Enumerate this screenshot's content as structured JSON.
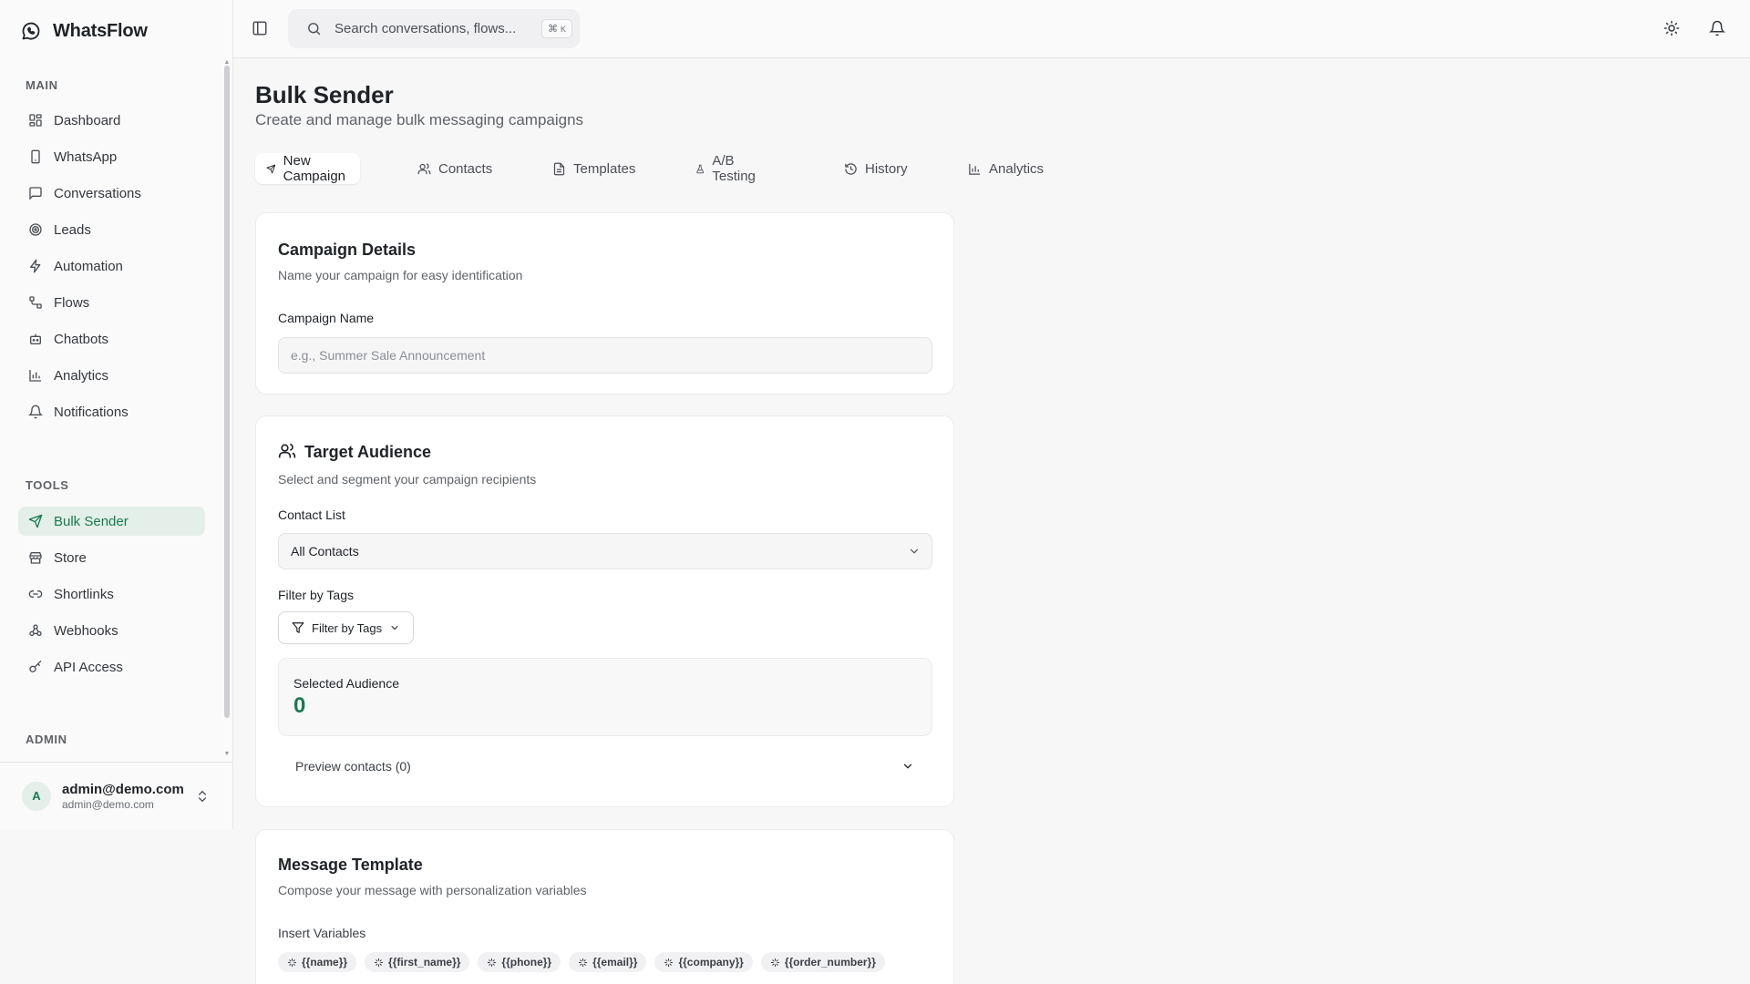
{
  "app": {
    "name": "WhatsFlow"
  },
  "sidebar": {
    "sections": {
      "main": "MAIN",
      "tools": "TOOLS",
      "admin": "ADMIN"
    },
    "main_items": [
      {
        "label": "Dashboard",
        "icon": "dashboard-icon"
      },
      {
        "label": "WhatsApp",
        "icon": "phone-icon"
      },
      {
        "label": "Conversations",
        "icon": "message-icon"
      },
      {
        "label": "Leads",
        "icon": "target-icon"
      },
      {
        "label": "Automation",
        "icon": "bolt-icon"
      },
      {
        "label": "Flows",
        "icon": "flow-icon"
      },
      {
        "label": "Chatbots",
        "icon": "bot-icon"
      },
      {
        "label": "Analytics",
        "icon": "chart-icon"
      },
      {
        "label": "Notifications",
        "icon": "bell-icon"
      }
    ],
    "tool_items": [
      {
        "label": "Bulk Sender",
        "icon": "send-icon",
        "active": true
      },
      {
        "label": "Store",
        "icon": "store-icon"
      },
      {
        "label": "Shortlinks",
        "icon": "link-icon"
      },
      {
        "label": "Webhooks",
        "icon": "webhook-icon"
      },
      {
        "label": "API Access",
        "icon": "key-icon"
      }
    ]
  },
  "user": {
    "avatar_letter": "A",
    "name": "admin@demo.com",
    "email": "admin@demo.com"
  },
  "topbar": {
    "search_placeholder": "Search conversations, flows...",
    "shortcut": {
      "symbol": "⌘",
      "key": "K"
    }
  },
  "page": {
    "title": "Bulk Sender",
    "subtitle": "Create and manage bulk messaging campaigns"
  },
  "tabs": [
    {
      "label": "New Campaign",
      "icon": "send-icon",
      "active": true
    },
    {
      "label": "Contacts",
      "icon": "users-icon"
    },
    {
      "label": "Templates",
      "icon": "file-icon"
    },
    {
      "label": "A/B Testing",
      "icon": "flask-icon"
    },
    {
      "label": "History",
      "icon": "history-icon"
    },
    {
      "label": "Analytics",
      "icon": "chart-icon"
    }
  ],
  "campaign_details": {
    "title": "Campaign Details",
    "description": "Name your campaign for easy identification",
    "name_label": "Campaign Name",
    "name_placeholder": "e.g., Summer Sale Announcement"
  },
  "target_audience": {
    "title": "Target Audience",
    "description": "Select and segment your campaign recipients",
    "contact_list_label": "Contact List",
    "contact_list_value": "All Contacts",
    "filter_label": "Filter by Tags",
    "filter_button": "Filter by Tags",
    "selected_label": "Selected Audience",
    "selected_count": "0",
    "preview_label": "Preview contacts (0)"
  },
  "message_template": {
    "title": "Message Template",
    "description": "Compose your message with personalization variables",
    "variables_label": "Insert Variables",
    "variables": [
      "{{name}}",
      "{{first_name}}",
      "{{phone}}",
      "{{email}}",
      "{{company}}",
      "{{order_number}}"
    ]
  },
  "colors": {
    "accent": "#1b7a4f",
    "accent_bg": "#e3efe8"
  }
}
